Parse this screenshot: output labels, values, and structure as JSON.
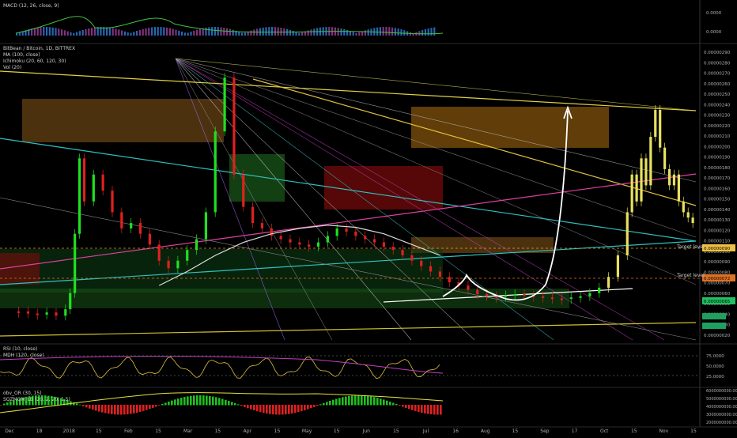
{
  "panes": {
    "macd_label": "MACD (12, 26, close, 9)",
    "main_labels": [
      "BitBean / Bitcoin, 1D, BITTREX",
      "MA (100, close)",
      "Ichimoku (20, 60, 120, 30)",
      "Vol (20)"
    ],
    "rsi_labels": [
      "RSI (10, close)",
      "MDH (120, close)"
    ],
    "osc_labels": [
      "obv_OR (30, 15)",
      "SQZMOM_LB (20, 2, 20, 1.5)"
    ]
  },
  "annotations": {
    "target_upper": "Target level",
    "target_lower": "Target level"
  },
  "chart_data": {
    "type": "line",
    "title": "BitBean / Bitcoin, 1D, BITTREX",
    "xlabel": "",
    "ylabel": "",
    "x_ticks": [
      "Dec",
      "18",
      "2018",
      "15",
      "Feb",
      "15",
      "Mar",
      "15",
      "Apr",
      "15",
      "May",
      "15",
      "Jun",
      "15",
      "Jul",
      "16",
      "Aug",
      "15",
      "Sep",
      "17",
      "Oct",
      "15",
      "Nov",
      "15"
    ],
    "y_ticks_main": [
      "0.00000290",
      "0.00000280",
      "0.00000270",
      "0.00000260",
      "0.00000250",
      "0.00000240",
      "0.00000230",
      "0.00000220",
      "0.00000210",
      "0.00000200",
      "0.00000190",
      "0.00000180",
      "0.00000170",
      "0.00000160",
      "0.00000150",
      "0.00000140",
      "0.00000130",
      "0.00000120",
      "0.00000110",
      "0.00000100",
      "0.00000090",
      "0.00000080",
      "0.00000070",
      "0.00000060",
      "0.00000050",
      "0.00000040",
      "0.00000030",
      "0.00000020"
    ],
    "y_ticks_macd": [
      "0.0000",
      "0.0000"
    ],
    "y_ticks_rsi": [
      "75.0000",
      "50.0000",
      "25.0000"
    ],
    "y_ticks_osc": [
      "6000000000.0000",
      "5000000000.0000",
      "4000000000.0000",
      "3000000000.0000",
      "2000000000.0000"
    ],
    "price_badges": [
      {
        "text": "0.00000090",
        "color": "#f0c040"
      },
      {
        "text": "0.00000072",
        "color": "#e07020"
      },
      {
        "text": "0.00000065",
        "color": "#20c060"
      }
    ],
    "ylim": [
      2e-07,
      2.9e-06
    ],
    "series": [
      {
        "name": "price",
        "x": [
          0,
          4,
          8,
          12,
          16,
          20,
          22,
          24,
          26,
          28,
          32,
          36,
          40,
          44,
          48,
          52,
          56,
          60,
          64,
          68,
          72,
          76,
          80,
          84,
          88,
          92,
          96,
          100,
          104,
          108,
          112,
          116,
          120,
          124,
          128,
          132,
          136,
          140,
          144,
          148,
          152,
          156,
          160,
          164,
          168,
          172,
          176,
          180,
          184,
          188,
          192,
          196,
          200,
          204,
          208,
          212,
          216,
          220,
          224,
          228,
          232,
          236,
          240,
          244,
          248,
          252,
          256,
          260,
          262,
          264,
          266,
          268,
          270,
          272,
          274,
          276,
          278,
          280,
          282,
          284,
          286,
          288
        ],
        "y": [
          4.8e-07,
          4.6e-07,
          4.5e-07,
          4.7e-07,
          4.4e-07,
          5e-07,
          6.5e-07,
          1.2e-06,
          1.9e-06,
          1.5e-06,
          1.75e-06,
          1.6e-06,
          1.4e-06,
          1.25e-06,
          1.3e-06,
          1.2e-06,
          1.1e-06,
          9.5e-07,
          8.8e-07,
          9.5e-07,
          1.05e-06,
          1.15e-06,
          1.4e-06,
          2.15e-06,
          2.65e-06,
          1.75e-06,
          1.45e-06,
          1.3e-06,
          1.25e-06,
          1.18e-06,
          1.15e-06,
          1.12e-06,
          1.1e-06,
          1.08e-06,
          1.12e-06,
          1.18e-06,
          1.25e-06,
          1.22e-06,
          1.18e-06,
          1.15e-06,
          1.12e-06,
          1.08e-06,
          1.05e-06,
          1e-06,
          9.5e-07,
          9e-07,
          8.5e-07,
          8e-07,
          7.5e-07,
          7.2e-07,
          6.8e-07,
          6.4e-07,
          6.2e-07,
          6.2e-07,
          6.3e-07,
          6.4e-07,
          6.3e-07,
          6.2e-07,
          6.1e-07,
          6e-07,
          6e-07,
          6.1e-07,
          6.2e-07,
          6.5e-07,
          7e-07,
          8e-07,
          1e-06,
          1.4e-06,
          1.75e-06,
          1.5e-06,
          1.9e-06,
          1.65e-06,
          2.1e-06,
          2.35e-06,
          2e-06,
          1.8e-06,
          1.65e-06,
          1.75e-06,
          1.5e-06,
          1.4e-06,
          1.35e-06,
          1.3e-06
        ]
      },
      {
        "name": "MA (100, close)",
        "x": [
          60,
          72,
          84,
          96,
          108,
          120,
          132,
          144,
          156,
          168,
          180
        ],
        "y": [
          7.2e-07,
          8.5e-07,
          1e-06,
          1.12e-06,
          1.2e-06,
          1.25e-06,
          1.28e-06,
          1.26e-06,
          1.2e-06,
          1.1e-06,
          1e-06
        ]
      }
    ],
    "grid": false,
    "legend": "top-left"
  }
}
